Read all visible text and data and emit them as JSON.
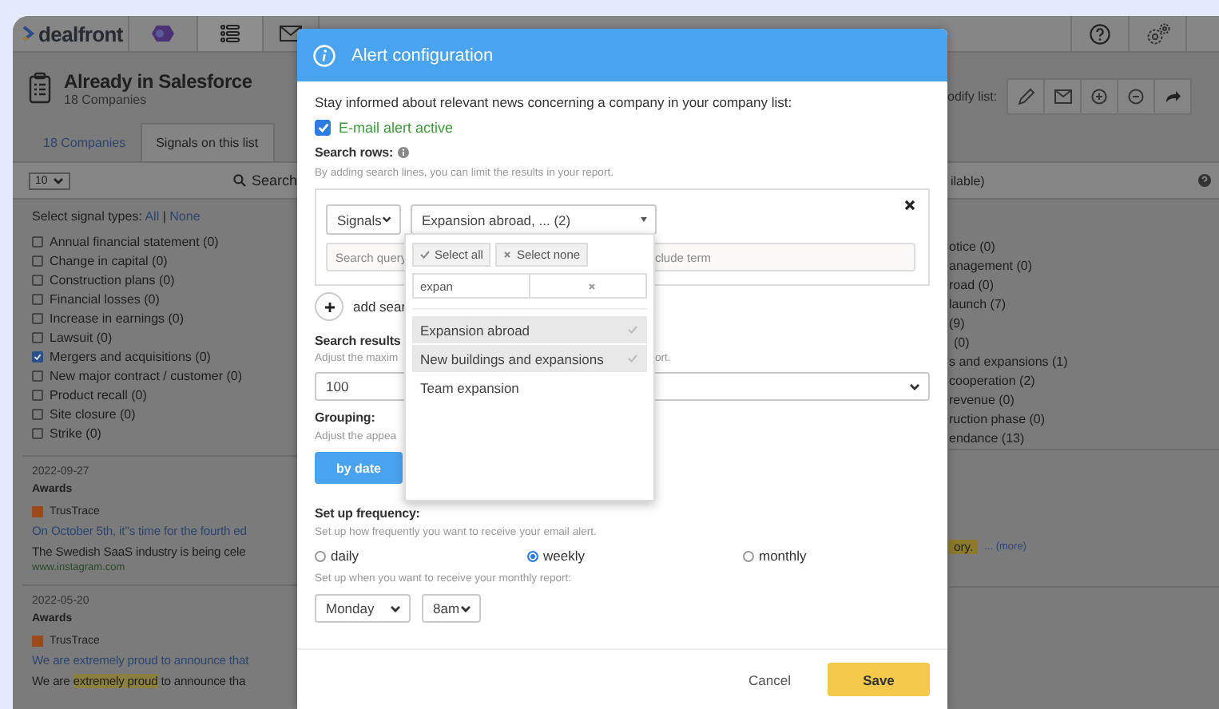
{
  "topbar": {
    "logo": "dealfront"
  },
  "header": {
    "title": "Already in Salesforce",
    "subtitle": "18 Companies",
    "modify_label": "odify list:"
  },
  "tabs": [
    {
      "label": "18 Companies",
      "selected": false
    },
    {
      "label": "Signals on this list",
      "selected": true
    }
  ],
  "filter_bar": {
    "page_size": "10",
    "search_label": "Search",
    "column_3": "ilable)"
  },
  "signal_types": {
    "label": "Select signal types:",
    "all": "All",
    "separator": "|",
    "none": "None",
    "items": [
      {
        "label": "Annual financial statement (0)",
        "checked": false
      },
      {
        "label": "Change in capital (0)",
        "checked": false
      },
      {
        "label": "Construction plans (0)",
        "checked": false
      },
      {
        "label": "Financial losses (0)",
        "checked": false
      },
      {
        "label": "Increase in earnings (0)",
        "checked": false
      },
      {
        "label": "Lawsuit (0)",
        "checked": false
      },
      {
        "label": "Mergers and acquisitions (0)",
        "checked": true
      },
      {
        "label": "New major contract / customer (0)",
        "checked": false
      },
      {
        "label": "Product recall (0)",
        "checked": false
      },
      {
        "label": "Site closure (0)",
        "checked": false
      },
      {
        "label": "Strike (0)",
        "checked": false
      }
    ]
  },
  "signal_types_column_2": [
    "otice (0)",
    "anagement (0)",
    "road (0)",
    "launch (7)",
    "(9)",
    "(0)",
    "s and expansions (1)",
    "cooperation (2)",
    "revenue (0)",
    "ruction phase (0)",
    "endance (13)"
  ],
  "news": [
    {
      "date": "2022-09-27",
      "category": "Awards",
      "source": "TrusTrace",
      "headline": "On October 5th, it''s time for the fourth ed",
      "snippet": [
        {
          "text": "The Swedish  SaaS industry is being cele",
          "highlight": false
        }
      ],
      "url": "www.instagram.com",
      "right_highlight": "ory.",
      "more": "... (more)"
    },
    {
      "date": "2022-05-20",
      "category": "Awards",
      "source": "TrusTrace",
      "headline": "We are extremely proud to announce that",
      "snippet": [
        {
          "text": "We are ",
          "highlight": false
        },
        {
          "text": "extremely",
          "highlight": true
        },
        {
          "text": " proud",
          "highlight": true
        },
        {
          "text": " to announce tha",
          "highlight": false
        }
      ]
    }
  ],
  "dialog": {
    "title": "Alert configuration",
    "intro": "Stay informed about relevant news concerning a company in your company list:",
    "email_alert": {
      "label": "E-mail alert active",
      "checked": true
    },
    "search_rows": {
      "heading": "Search rows:",
      "hint": "By adding search lines, you can limit the results in your report.",
      "field_type": "Signals",
      "signal_select": "Expansion abroad, ... (2)",
      "query_placeholder": "Search query",
      "exclude_placeholder": "clude term",
      "add_label": "add sear"
    },
    "signal_dropdown": {
      "select_all": "Select all",
      "select_none": "Select none",
      "filter_value": "expan",
      "options": [
        {
          "label": "Expansion abroad",
          "selected": true
        },
        {
          "label": "New buildings and expansions",
          "selected": true
        },
        {
          "label": "Team expansion",
          "selected": false
        }
      ]
    },
    "search_results": {
      "heading": "Search results",
      "hint_start": "Adjust the maxim",
      "hint_end": "ort.",
      "value": "100"
    },
    "grouping": {
      "heading": "Grouping:",
      "hint": "Adjust the appea",
      "options": [
        {
          "label": "by date",
          "selected": true
        }
      ]
    },
    "frequency": {
      "heading": "Set up frequency:",
      "hint": "Set up how frequently you want to receive your email alert.",
      "options": [
        {
          "label": "daily",
          "selected": false
        },
        {
          "label": "weekly",
          "selected": true
        },
        {
          "label": "monthly",
          "selected": false
        }
      ],
      "schedule_hint": "Set up when you want to receive your monthly report:",
      "day": "Monday",
      "time": "8am"
    },
    "buttons": [
      {
        "label": "Cancel",
        "kind": "secondary"
      },
      {
        "label": "Save",
        "kind": "primary"
      }
    ]
  }
}
